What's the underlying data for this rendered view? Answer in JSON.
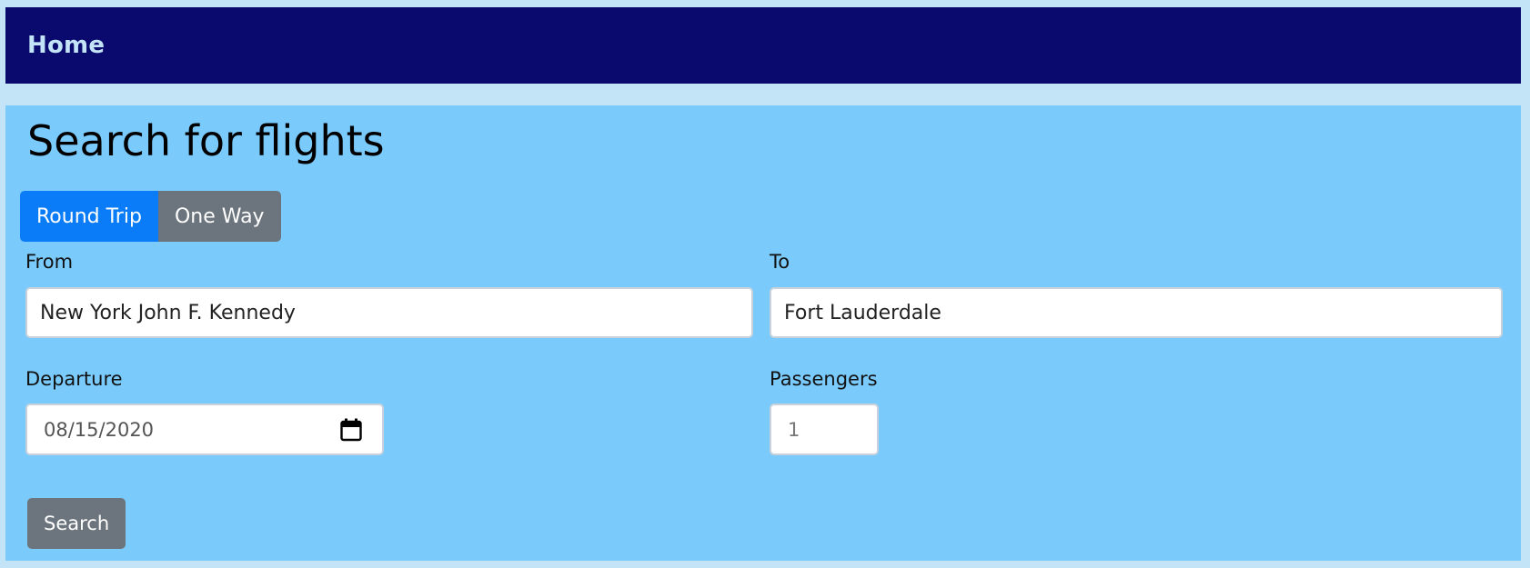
{
  "nav": {
    "home_label": "Home"
  },
  "page": {
    "title": "Search for flights"
  },
  "trip_type": {
    "round_trip_label": "Round Trip",
    "one_way_label": "One Way",
    "selected": "Round Trip"
  },
  "form": {
    "from": {
      "label": "From",
      "value": "New York John F. Kennedy"
    },
    "to": {
      "label": "To",
      "value": "Fort Lauderdale"
    },
    "departure": {
      "label": "Departure",
      "value": "08/15/2020"
    },
    "passengers": {
      "label": "Passengers",
      "value": "1"
    },
    "search_label": "Search"
  },
  "colors": {
    "navbar_bg": "#0a0a6e",
    "page_bg": "#c3e3f7",
    "panel_bg": "#7acbfc",
    "primary": "#0a7cf7",
    "secondary": "#6c757d"
  },
  "icons": {
    "calendar": "calendar-icon"
  }
}
